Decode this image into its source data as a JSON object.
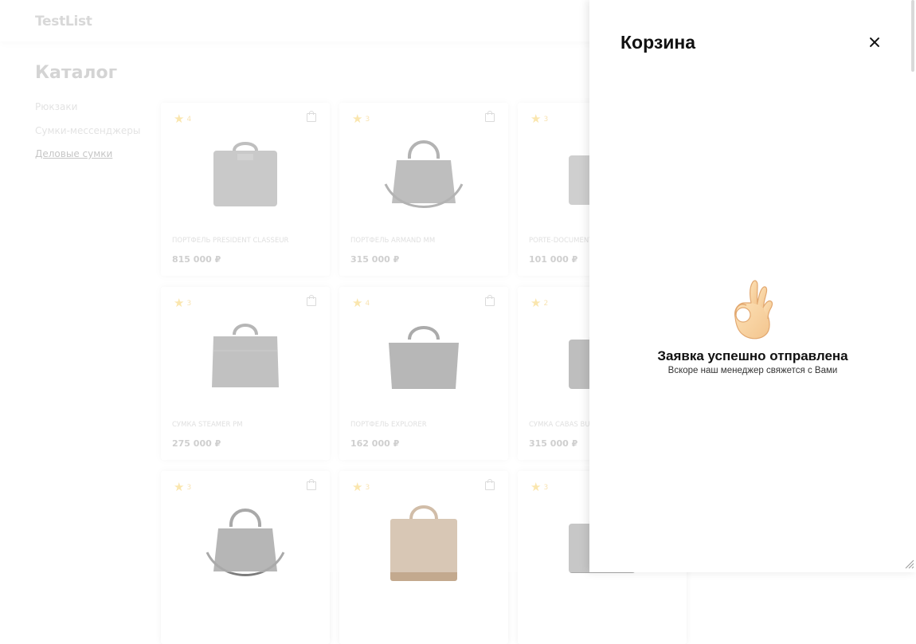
{
  "header": {
    "logo": "TestList"
  },
  "catalog": {
    "title": "Каталог",
    "categories": [
      {
        "label": "Рюкзаки",
        "active": false
      },
      {
        "label": "Сумки-мессенджеры",
        "active": false
      },
      {
        "label": "Деловые сумки",
        "active": true
      }
    ]
  },
  "products": [
    {
      "rating": "4",
      "name": "ПОРТФЕЛЬ PRESIDENT CLASSEUR",
      "price": "815 000 ₽",
      "bag": "briefcase-hard",
      "color": "#9d9d9d"
    },
    {
      "rating": "3",
      "name": "ПОРТФЕЛЬ ARMAND MM",
      "price": "315 000 ₽",
      "bag": "tote-strap",
      "color": "#8a8a8a"
    },
    {
      "rating": "3",
      "name": "PORTE-DOCUMENT",
      "price": "101 000 ₽",
      "bag": "side",
      "color": "#a8a8a8"
    },
    {
      "rating": "3",
      "name": "СУМКА STEAMER PM",
      "price": "275 000 ₽",
      "bag": "steamer",
      "color": "#8f8f8f"
    },
    {
      "rating": "4",
      "name": "ПОРТФЕЛЬ EXPLORER",
      "price": "162 000 ₽",
      "bag": "explorer",
      "color": "#7e7e7e"
    },
    {
      "rating": "2",
      "name": "СУМКА CABAS BU",
      "price": "315 000 ₽",
      "bag": "side",
      "color": "#8a8a8a"
    },
    {
      "rating": "3",
      "name": "",
      "price": "",
      "bag": "tote-strap",
      "color": "#7c7c7c"
    },
    {
      "rating": "3",
      "name": "",
      "price": "",
      "bag": "mono",
      "color": "#b89a7a"
    },
    {
      "rating": "3",
      "name": "",
      "price": "",
      "bag": "side",
      "color": "#9a9a9a"
    }
  ],
  "cart": {
    "title": "Корзина",
    "close_icon": "close-icon",
    "success_icon": "ok-hand-icon",
    "success_title": "Заявка успешно отправлена",
    "success_subtitle": "Вскоре наш менеджер свяжется с Вами"
  }
}
